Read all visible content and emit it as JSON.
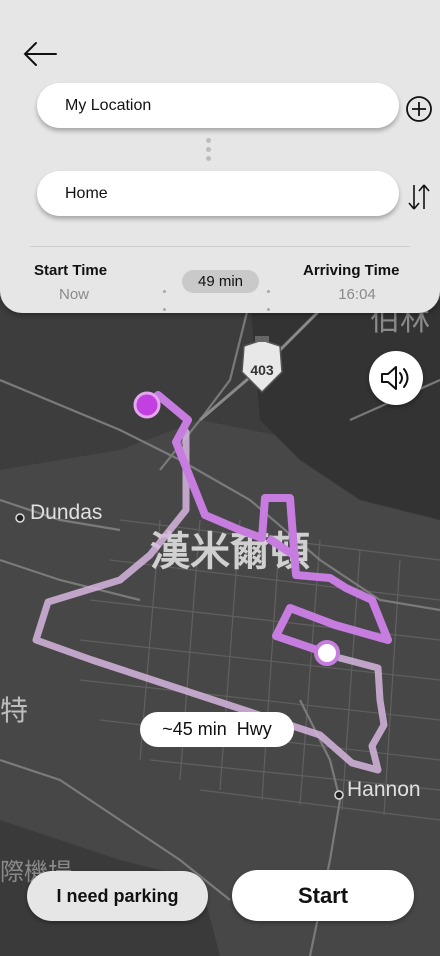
{
  "header": {
    "back_icon": "arrow-left-icon",
    "origin": "My Location",
    "destination": "Home",
    "add_stop_icon": "plus-circle-icon",
    "swap_icon": "swap-vertical-icon"
  },
  "trip": {
    "start_time_label": "Start Time",
    "start_time_value": "Now",
    "duration": "49 min",
    "arrival_label": "Arriving Time",
    "arrival_value": "16:04"
  },
  "map": {
    "highway_shield": "403",
    "places": [
      "Dundas",
      "Hannon"
    ],
    "cjk_labels": [
      "漢米爾頓",
      "伯林",
      "特",
      "際機場"
    ],
    "route_color": "#c77ce0",
    "alt_route_color": "#d7b6e0",
    "origin_marker_color": "#c23fe0",
    "route_label": "~45 min  Hwy",
    "sound_icon": "speaker-volume-icon"
  },
  "actions": {
    "parking_label": "I need parking",
    "start_label": "Start"
  }
}
